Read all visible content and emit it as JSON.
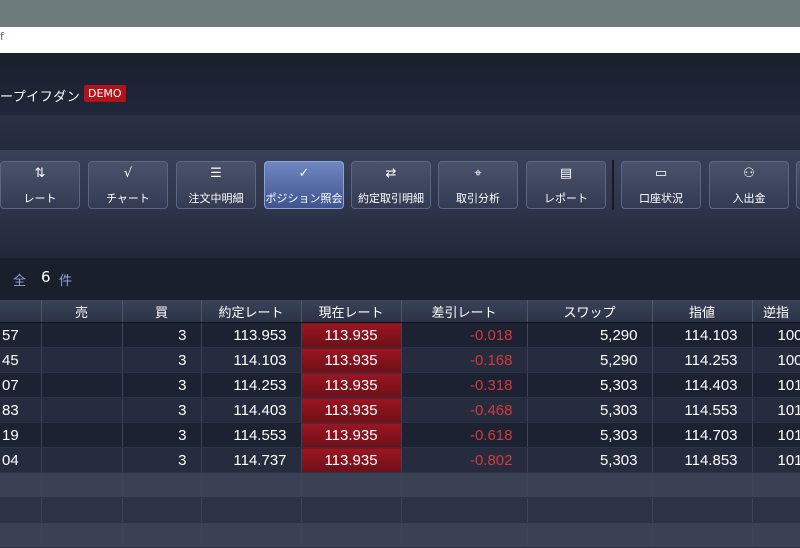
{
  "browser": {
    "url_fragment": "f"
  },
  "app": {
    "title": "ープイフダン",
    "mode_badge": "DEMO"
  },
  "toolbar": {
    "buttons": [
      {
        "icon": "⇅",
        "label": "レート"
      },
      {
        "icon": "√",
        "label": "チャート"
      },
      {
        "icon": "☰",
        "label": "注文中明細"
      },
      {
        "icon": "✓",
        "label": "ポジション照会"
      },
      {
        "icon": "⇄",
        "label": "約定取引明細"
      },
      {
        "icon": "⌖",
        "label": "取引分析"
      },
      {
        "icon": "▤",
        "label": "レポート"
      },
      {
        "icon": "▭",
        "label": "口座状況"
      },
      {
        "icon": "⚇",
        "label": "入出金"
      }
    ]
  },
  "summary": {
    "label": "全",
    "count": "6",
    "unit": "件"
  },
  "table": {
    "columns": [
      "",
      "売",
      "買",
      "約定レート",
      "現在レート",
      "差引レート",
      "スワップ",
      "指値",
      "逆指"
    ],
    "rows": [
      {
        "id": "57",
        "sell": "",
        "buy": "3",
        "entry": "113.953",
        "current": "113.935",
        "diff": "-0.018",
        "swap": "5,290",
        "limit": "114.103",
        "stop": "100"
      },
      {
        "id": "45",
        "sell": "",
        "buy": "3",
        "entry": "114.103",
        "current": "113.935",
        "diff": "-0.168",
        "swap": "5,290",
        "limit": "114.253",
        "stop": "100"
      },
      {
        "id": "07",
        "sell": "",
        "buy": "3",
        "entry": "114.253",
        "current": "113.935",
        "diff": "-0.318",
        "swap": "5,303",
        "limit": "114.403",
        "stop": "101"
      },
      {
        "id": "83",
        "sell": "",
        "buy": "3",
        "entry": "114.403",
        "current": "113.935",
        "diff": "-0.468",
        "swap": "5,303",
        "limit": "114.553",
        "stop": "101"
      },
      {
        "id": "19",
        "sell": "",
        "buy": "3",
        "entry": "114.553",
        "current": "113.935",
        "diff": "-0.618",
        "swap": "5,303",
        "limit": "114.703",
        "stop": "101"
      },
      {
        "id": "04",
        "sell": "",
        "buy": "3",
        "entry": "114.737",
        "current": "113.935",
        "diff": "-0.802",
        "swap": "5,303",
        "limit": "114.853",
        "stop": "101"
      }
    ]
  },
  "colors": {
    "accent_active": "#4f67a8",
    "badge_red": "#b3121a",
    "current_rate_bg": "#8a1420",
    "negative_text": "#d13a3a"
  }
}
